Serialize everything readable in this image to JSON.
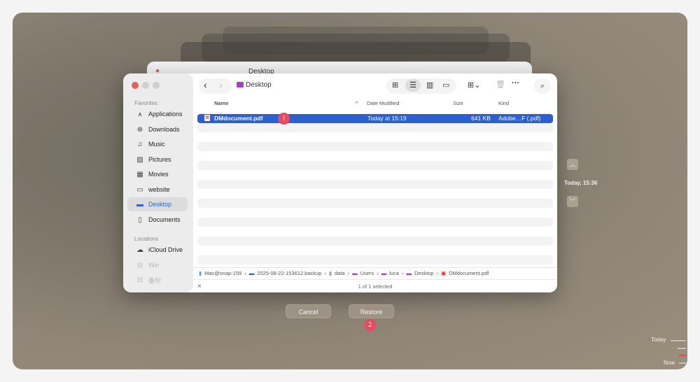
{
  "back_window": {
    "title": "Desktop"
  },
  "window": {
    "title": "Desktop",
    "sidebar": {
      "favorites_header": "Favorites",
      "favorites": [
        {
          "label": "Applications",
          "icon": "applications-icon"
        },
        {
          "label": "Downloads",
          "icon": "downloads-icon"
        },
        {
          "label": "Music",
          "icon": "music-icon"
        },
        {
          "label": "Pictures",
          "icon": "pictures-icon"
        },
        {
          "label": "Movies",
          "icon": "movies-icon"
        },
        {
          "label": "website",
          "icon": "folder-icon"
        },
        {
          "label": "Desktop",
          "icon": "desktop-icon",
          "selected": true
        },
        {
          "label": "Documents",
          "icon": "document-icon"
        }
      ],
      "locations_header": "Locations",
      "locations": [
        {
          "label": "iCloud Drive",
          "icon": "cloud-icon"
        },
        {
          "label": "Win",
          "icon": "drive-icon",
          "disabled": true
        },
        {
          "label": "备份",
          "icon": "drive-icon",
          "disabled": true
        }
      ]
    },
    "columns": {
      "name": "Name",
      "date": "Date Modified",
      "size": "Size",
      "kind": "Kind"
    },
    "file": {
      "name": "DMdocument.pdf",
      "date": "Today at 15:19",
      "size": "641 KB",
      "kind": "Adobe…F (.pdf)"
    },
    "path": [
      "Mac@snap-159",
      "2025-08-22-153612.backup",
      "data",
      "Users",
      "luca",
      "Desktop",
      "DMdocument.pdf"
    ],
    "status": "1 of 1 selected"
  },
  "buttons": {
    "cancel": "Cancel",
    "restore": "Restore"
  },
  "badges": {
    "one": "1",
    "two": "2"
  },
  "timeline": {
    "current": "Today, 15:36",
    "today": "Today",
    "now": "Now"
  }
}
